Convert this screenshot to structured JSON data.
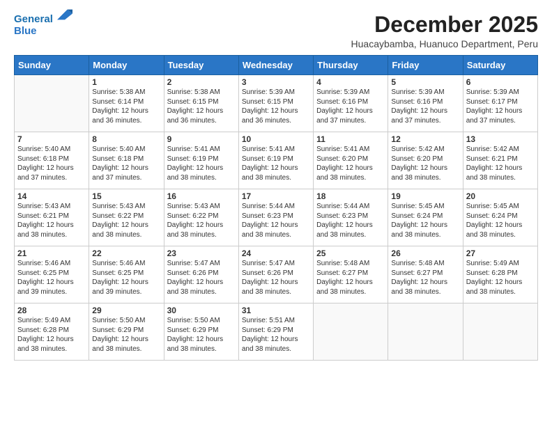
{
  "app": {
    "logo_line1": "General",
    "logo_line2": "Blue"
  },
  "header": {
    "title": "December 2025",
    "subtitle": "Huacaybamba, Huanuco Department, Peru"
  },
  "calendar": {
    "days_of_week": [
      "Sunday",
      "Monday",
      "Tuesday",
      "Wednesday",
      "Thursday",
      "Friday",
      "Saturday"
    ],
    "weeks": [
      [
        {
          "day": "",
          "info": ""
        },
        {
          "day": "1",
          "info": "Sunrise: 5:38 AM\nSunset: 6:14 PM\nDaylight: 12 hours and 36 minutes."
        },
        {
          "day": "2",
          "info": "Sunrise: 5:38 AM\nSunset: 6:15 PM\nDaylight: 12 hours and 36 minutes."
        },
        {
          "day": "3",
          "info": "Sunrise: 5:39 AM\nSunset: 6:15 PM\nDaylight: 12 hours and 36 minutes."
        },
        {
          "day": "4",
          "info": "Sunrise: 5:39 AM\nSunset: 6:16 PM\nDaylight: 12 hours and 37 minutes."
        },
        {
          "day": "5",
          "info": "Sunrise: 5:39 AM\nSunset: 6:16 PM\nDaylight: 12 hours and 37 minutes."
        },
        {
          "day": "6",
          "info": "Sunrise: 5:39 AM\nSunset: 6:17 PM\nDaylight: 12 hours and 37 minutes."
        }
      ],
      [
        {
          "day": "7",
          "info": "Sunrise: 5:40 AM\nSunset: 6:18 PM\nDaylight: 12 hours and 37 minutes."
        },
        {
          "day": "8",
          "info": "Sunrise: 5:40 AM\nSunset: 6:18 PM\nDaylight: 12 hours and 37 minutes."
        },
        {
          "day": "9",
          "info": "Sunrise: 5:41 AM\nSunset: 6:19 PM\nDaylight: 12 hours and 38 minutes."
        },
        {
          "day": "10",
          "info": "Sunrise: 5:41 AM\nSunset: 6:19 PM\nDaylight: 12 hours and 38 minutes."
        },
        {
          "day": "11",
          "info": "Sunrise: 5:41 AM\nSunset: 6:20 PM\nDaylight: 12 hours and 38 minutes."
        },
        {
          "day": "12",
          "info": "Sunrise: 5:42 AM\nSunset: 6:20 PM\nDaylight: 12 hours and 38 minutes."
        },
        {
          "day": "13",
          "info": "Sunrise: 5:42 AM\nSunset: 6:21 PM\nDaylight: 12 hours and 38 minutes."
        }
      ],
      [
        {
          "day": "14",
          "info": "Sunrise: 5:43 AM\nSunset: 6:21 PM\nDaylight: 12 hours and 38 minutes."
        },
        {
          "day": "15",
          "info": "Sunrise: 5:43 AM\nSunset: 6:22 PM\nDaylight: 12 hours and 38 minutes."
        },
        {
          "day": "16",
          "info": "Sunrise: 5:43 AM\nSunset: 6:22 PM\nDaylight: 12 hours and 38 minutes."
        },
        {
          "day": "17",
          "info": "Sunrise: 5:44 AM\nSunset: 6:23 PM\nDaylight: 12 hours and 38 minutes."
        },
        {
          "day": "18",
          "info": "Sunrise: 5:44 AM\nSunset: 6:23 PM\nDaylight: 12 hours and 38 minutes."
        },
        {
          "day": "19",
          "info": "Sunrise: 5:45 AM\nSunset: 6:24 PM\nDaylight: 12 hours and 38 minutes."
        },
        {
          "day": "20",
          "info": "Sunrise: 5:45 AM\nSunset: 6:24 PM\nDaylight: 12 hours and 38 minutes."
        }
      ],
      [
        {
          "day": "21",
          "info": "Sunrise: 5:46 AM\nSunset: 6:25 PM\nDaylight: 12 hours and 39 minutes."
        },
        {
          "day": "22",
          "info": "Sunrise: 5:46 AM\nSunset: 6:25 PM\nDaylight: 12 hours and 39 minutes."
        },
        {
          "day": "23",
          "info": "Sunrise: 5:47 AM\nSunset: 6:26 PM\nDaylight: 12 hours and 38 minutes."
        },
        {
          "day": "24",
          "info": "Sunrise: 5:47 AM\nSunset: 6:26 PM\nDaylight: 12 hours and 38 minutes."
        },
        {
          "day": "25",
          "info": "Sunrise: 5:48 AM\nSunset: 6:27 PM\nDaylight: 12 hours and 38 minutes."
        },
        {
          "day": "26",
          "info": "Sunrise: 5:48 AM\nSunset: 6:27 PM\nDaylight: 12 hours and 38 minutes."
        },
        {
          "day": "27",
          "info": "Sunrise: 5:49 AM\nSunset: 6:28 PM\nDaylight: 12 hours and 38 minutes."
        }
      ],
      [
        {
          "day": "28",
          "info": "Sunrise: 5:49 AM\nSunset: 6:28 PM\nDaylight: 12 hours and 38 minutes."
        },
        {
          "day": "29",
          "info": "Sunrise: 5:50 AM\nSunset: 6:29 PM\nDaylight: 12 hours and 38 minutes."
        },
        {
          "day": "30",
          "info": "Sunrise: 5:50 AM\nSunset: 6:29 PM\nDaylight: 12 hours and 38 minutes."
        },
        {
          "day": "31",
          "info": "Sunrise: 5:51 AM\nSunset: 6:29 PM\nDaylight: 12 hours and 38 minutes."
        },
        {
          "day": "",
          "info": ""
        },
        {
          "day": "",
          "info": ""
        },
        {
          "day": "",
          "info": ""
        }
      ]
    ]
  }
}
